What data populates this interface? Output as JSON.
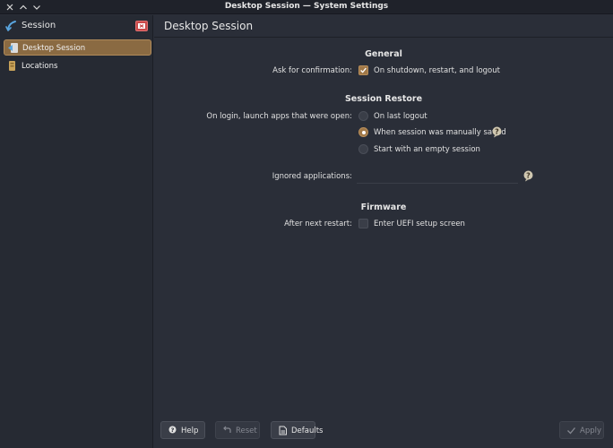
{
  "window": {
    "title": "Desktop Session — System Settings"
  },
  "sidebar": {
    "header_label": "Session",
    "items": [
      {
        "label": "Desktop Session",
        "icon": "desktop-session-icon",
        "active": true
      },
      {
        "label": "Locations",
        "icon": "locations-icon",
        "active": false
      }
    ]
  },
  "page": {
    "title": "Desktop Session"
  },
  "general": {
    "title": "General",
    "confirm_label": "Ask for confirmation:",
    "confirm_option": "On shutdown, restart, and logout",
    "confirm_checked": true
  },
  "session_restore": {
    "title": "Session Restore",
    "launch_label": "On login, launch apps that were open:",
    "options": [
      {
        "label": "On last logout",
        "selected": false
      },
      {
        "label": "When session was manually saved",
        "selected": true
      },
      {
        "label": "Start with an empty session",
        "selected": false
      }
    ],
    "ignored_label": "Ignored applications:",
    "ignored_value": ""
  },
  "firmware": {
    "title": "Firmware",
    "restart_label": "After next restart:",
    "uefi_option": "Enter UEFI setup screen",
    "uefi_checked": false
  },
  "buttons": {
    "help": "Help",
    "reset": "Reset",
    "defaults": "Defaults",
    "apply": "Apply"
  },
  "colors": {
    "accent": "#a07848",
    "background": "#2a2e38",
    "sidebar": "#262a33"
  }
}
